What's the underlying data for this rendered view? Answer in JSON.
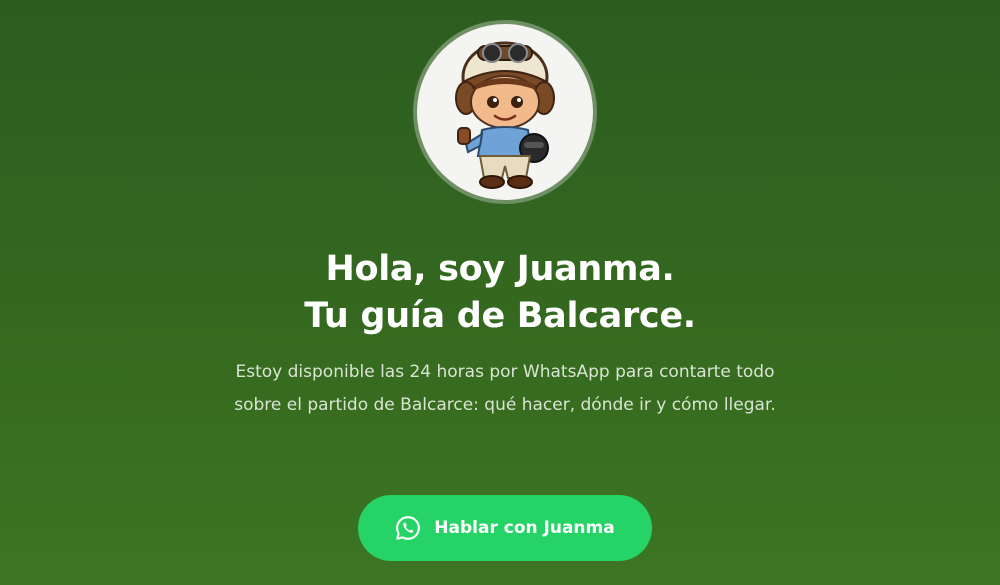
{
  "hero": {
    "avatar": {
      "icon": "mascot-avatar",
      "description_colors": {
        "ring": "#6f8f64",
        "background": "#f4f4f2"
      }
    },
    "headline_line1": "Hola, soy Juanma.",
    "headline_line2": "Tu guía de Balcarce.",
    "subtitle": "Estoy disponible las 24 horas por WhatsApp para contarte todo sobre el partido de Balcarce: qué hacer, dónde ir y cómo llegar.",
    "cta": {
      "label": "Hablar con Juanma",
      "icon": "whatsapp-icon",
      "color": "#25d366"
    }
  },
  "colors": {
    "background_top": "#2b5d20",
    "background_bottom": "#3d7523",
    "text": "#ffffff",
    "subtitle_text": "#d9e4d3"
  }
}
